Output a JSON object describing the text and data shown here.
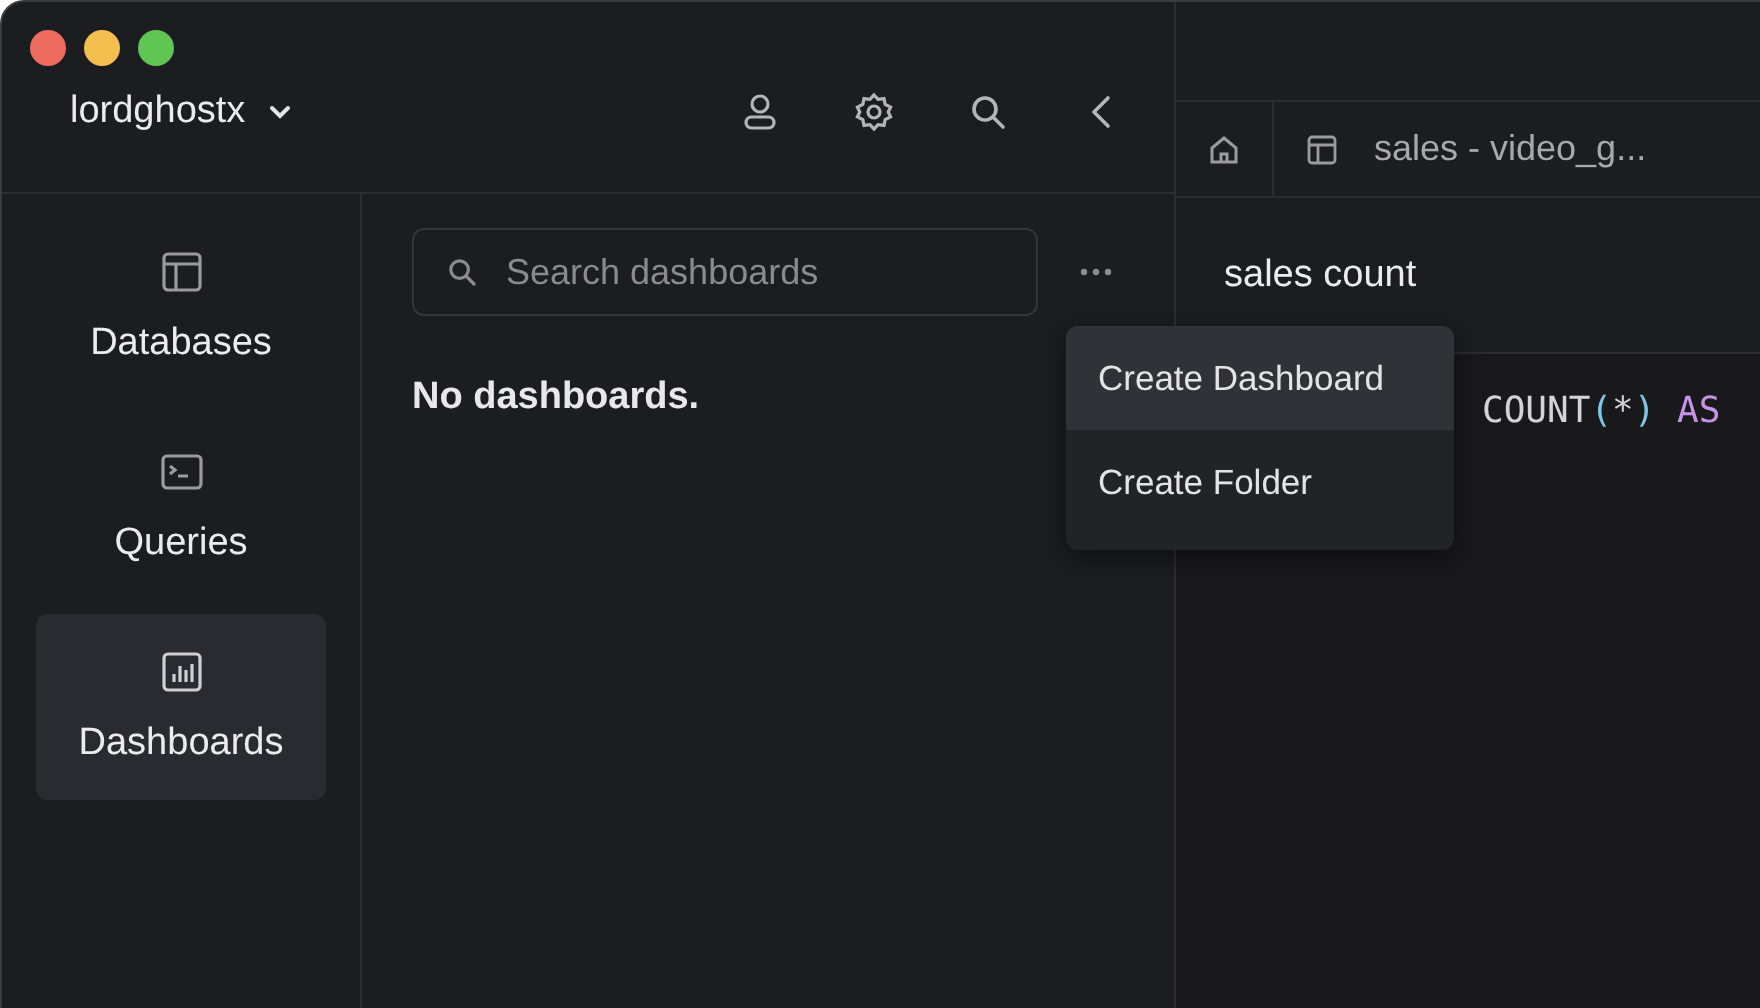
{
  "account": {
    "name": "lordghostx"
  },
  "toolbar": [
    {
      "kind": "user"
    },
    {
      "kind": "settings"
    },
    {
      "kind": "search"
    },
    {
      "kind": "back"
    }
  ],
  "sidebar": {
    "items": [
      {
        "label": "Databases",
        "kind": "databases",
        "selected": false
      },
      {
        "label": "Queries",
        "kind": "queries",
        "selected": false
      },
      {
        "label": "Dashboards",
        "kind": "dashboards",
        "selected": true
      }
    ]
  },
  "panel": {
    "search": {
      "placeholder": "Search dashboards"
    },
    "empty_message": "No dashboards."
  },
  "menu": {
    "items": [
      {
        "label": "Create Dashboard",
        "selected": true
      },
      {
        "label": "Create Folder",
        "selected": false
      }
    ]
  },
  "tabs": [
    {
      "kind": "home"
    },
    {
      "kind": "table",
      "label": "sales - video_g..."
    }
  ],
  "query": {
    "title": "sales count",
    "code": [
      {
        "text": "COUNT",
        "kind": "function"
      },
      {
        "text": "(",
        "kind": "paren"
      },
      {
        "text": "*",
        "kind": "operator"
      },
      {
        "text": ")",
        "kind": "paren"
      },
      {
        "text": " AS",
        "kind": "keyword"
      }
    ]
  }
}
